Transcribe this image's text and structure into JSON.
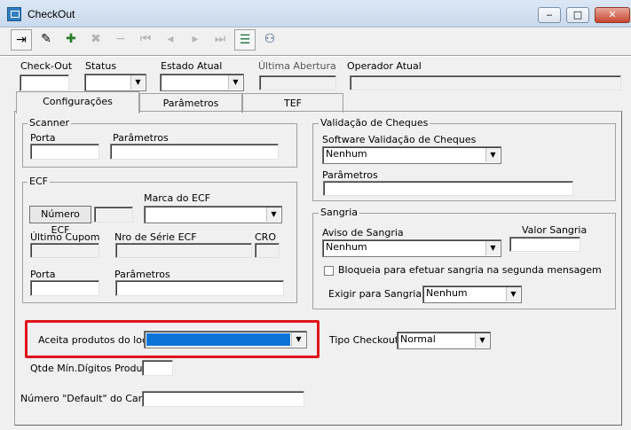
{
  "window": {
    "title": "CheckOut",
    "minimize": "‒",
    "maximize": "□",
    "close": "✕"
  },
  "toolbar": {
    "buttons": [
      {
        "icon": "exit-icon",
        "glyph": "⇥",
        "enabled": true
      },
      {
        "icon": "edit-icon",
        "glyph": "✎",
        "enabled": true
      },
      {
        "icon": "add-icon",
        "glyph": "✚",
        "enabled": true
      },
      {
        "icon": "remove-icon",
        "glyph": "✖",
        "enabled": false
      },
      {
        "icon": "delete-icon",
        "glyph": "−",
        "enabled": false
      },
      {
        "icon": "first-icon",
        "glyph": "⏮",
        "enabled": false
      },
      {
        "icon": "prev-icon",
        "glyph": "◂",
        "enabled": false
      },
      {
        "icon": "next-icon",
        "glyph": "▸",
        "enabled": false
      },
      {
        "icon": "last-icon",
        "glyph": "⏭",
        "enabled": false
      },
      {
        "icon": "list-icon",
        "glyph": "☰",
        "enabled": true
      },
      {
        "icon": "search-icon",
        "glyph": "⚇",
        "enabled": true
      }
    ]
  },
  "header": {
    "checkout_label": "Check-Out",
    "status_label": "Status",
    "estado_label": "Estado Atual",
    "ultima_label": "Última Abertura",
    "operador_label": "Operador Atual"
  },
  "tabs": [
    "Configurações",
    "Parâmetros",
    "TEF"
  ],
  "scanner": {
    "title": "Scanner",
    "porta_label": "Porta",
    "parametros_label": "Parâmetros"
  },
  "ecf": {
    "title": "ECF",
    "numero_button": "Número ECF",
    "marca_label": "Marca do ECF",
    "ultimo_cupom_label": "Último Cupom",
    "serie_label": "Nro de Série ECF",
    "cro_label": "CRO",
    "porta_label": "Porta",
    "parametros_label": "Parâmetros"
  },
  "validacao": {
    "title": "Validação de Cheques",
    "software_label": "Software Validação de Cheques",
    "software_value": "Nenhum",
    "parametros_label": "Parâmetros"
  },
  "sangria": {
    "title": "Sangria",
    "aviso_label": "Aviso de Sangria",
    "aviso_value": "Nenhum",
    "valor_label": "Valor Sangria",
    "bloqueia_label": "Bloqueia para efetuar sangria na segunda mensagem",
    "exigir_label": "Exigir para Sangria",
    "exigir_value": "Nenhum"
  },
  "bottom": {
    "aceita_label": "Aceita produtos do local",
    "tipo_label": "Tipo Checkout",
    "tipo_value": "Normal",
    "qtde_label": "Qtde Mín.Dígitos Produto",
    "numero_default_label": "Número \"Default\" do Cartão"
  },
  "colors": {
    "highlight_border": "#e0141c",
    "selection": "#0a74d6"
  }
}
